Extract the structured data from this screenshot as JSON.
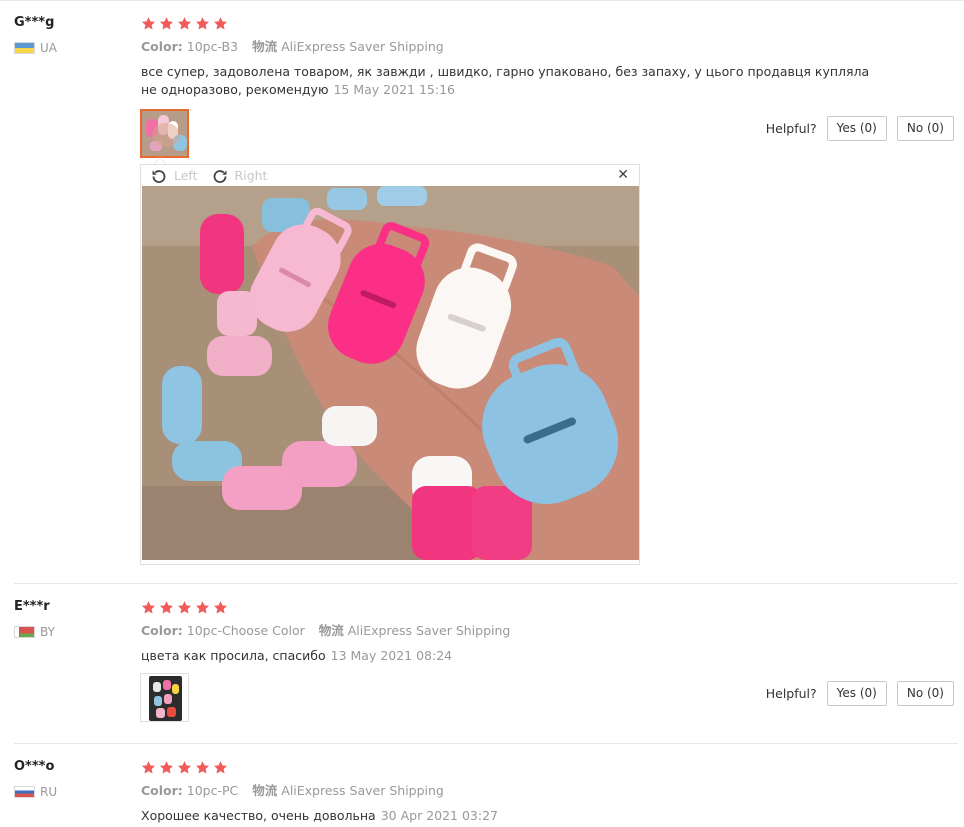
{
  "accent_star_color": "#f05b5b",
  "reviews": [
    {
      "user": "G***g",
      "country": "UA",
      "rating": 5,
      "color_label": "Color:",
      "color_value": "10pc-B3",
      "logistics_label": "物流",
      "logistics_value": "AliExpress Saver Shipping",
      "text": "все супер, задоволена товаром, як завжди , швидко, гарно упаковано, без запаху, у цього продавця купляла не одноразово, рекомендую",
      "date": "15 May 2021 15:16",
      "helpful_label": "Helpful?",
      "yes_label": "Yes (0)",
      "no_label": "No (0)"
    },
    {
      "user": "E***r",
      "country": "BY",
      "rating": 5,
      "color_label": "Color:",
      "color_value": "10pc-Choose Color",
      "logistics_label": "物流",
      "logistics_value": "AliExpress Saver Shipping",
      "text": "цвета как просила, спасибо",
      "date": "13 May 2021 08:24",
      "helpful_label": "Helpful?",
      "yes_label": "Yes (0)",
      "no_label": "No (0)"
    },
    {
      "user": "O***o",
      "country": "RU",
      "rating": 5,
      "color_label": "Color:",
      "color_value": "10pc-PC",
      "logistics_label": "物流",
      "logistics_value": "AliExpress Saver Shipping",
      "text": "Хорошее качество, очень довольна",
      "date": "30 Apr 2021 03:27"
    }
  ],
  "viewer": {
    "rotate_left_label": "Left",
    "rotate_right_label": "Right",
    "close_icon": "close-icon"
  }
}
